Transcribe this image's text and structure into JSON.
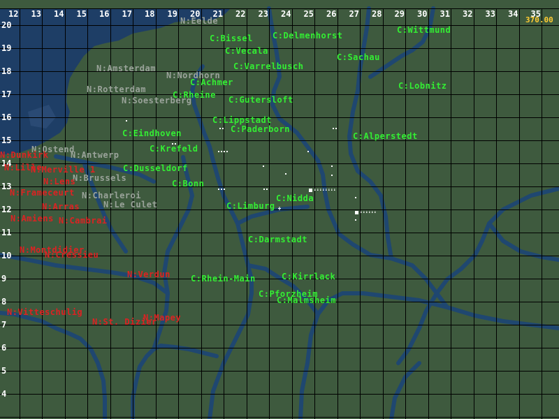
{
  "map": {
    "x_axis": [
      "12",
      "13",
      "14",
      "15",
      "16",
      "17",
      "18",
      "19",
      "20",
      "21",
      "22",
      "23",
      "24",
      "25",
      "26",
      "27",
      "28",
      "29",
      "30",
      "31",
      "32",
      "33",
      "34",
      "35"
    ],
    "y_axis": [
      "20",
      "19",
      "18",
      "17",
      "16",
      "15",
      "14",
      "13",
      "12",
      "11",
      "10",
      "9",
      "8",
      "7",
      "6",
      "5",
      "4"
    ],
    "timer": "370.00",
    "colors": {
      "land": "#3e5a3e",
      "water": "#1e3e66",
      "river": "#1f4770",
      "grid": "#000000",
      "neutral": "#9aa39a",
      "allied": "#33ee33",
      "enemy": "#dd2222"
    },
    "neutral_places": [
      "N:Eelde",
      "N:Amsterdam",
      "N:Nordhorn",
      "N:Rotterdam",
      "N:Soesterberg",
      "N:Ostend",
      "N:Antwerp",
      "N:Brussels",
      "N:Charleroi",
      "N:Le Culet"
    ],
    "allied_places": [
      "C:Wittmund",
      "C:Bissel",
      "C:Delmenhorst",
      "C:Vecala",
      "C:Sachau",
      "C:Varrelbusch",
      "C:Achmer",
      "C:Lobnitz",
      "C:Rheine",
      "C:Gutersloft",
      "C:Lippstadt",
      "C:Paderborn",
      "C:Eindhoven",
      "C:Alperstedt",
      "C:Krefeld",
      "C:Dusseldorf",
      "C:Bonn",
      "C:Nidda",
      "C:Limburg",
      "C:Darmstadt",
      "C:Rhein-Main",
      "C:Kirrlack",
      "C:Pforzheim",
      "C:Malmsheim"
    ],
    "enemy_places": [
      "N:Dunkirk",
      "N:Lille",
      "N:Merville 1",
      "N:Lens",
      "N:Frameceurt",
      "N:Arras",
      "N:Amiens",
      "N:Cambrai",
      "N:Montdidier",
      "N:Cressieu",
      "N:Verdun",
      "N:Vitteschulig",
      "N:St. Dizier",
      "N:Mapey"
    ]
  }
}
